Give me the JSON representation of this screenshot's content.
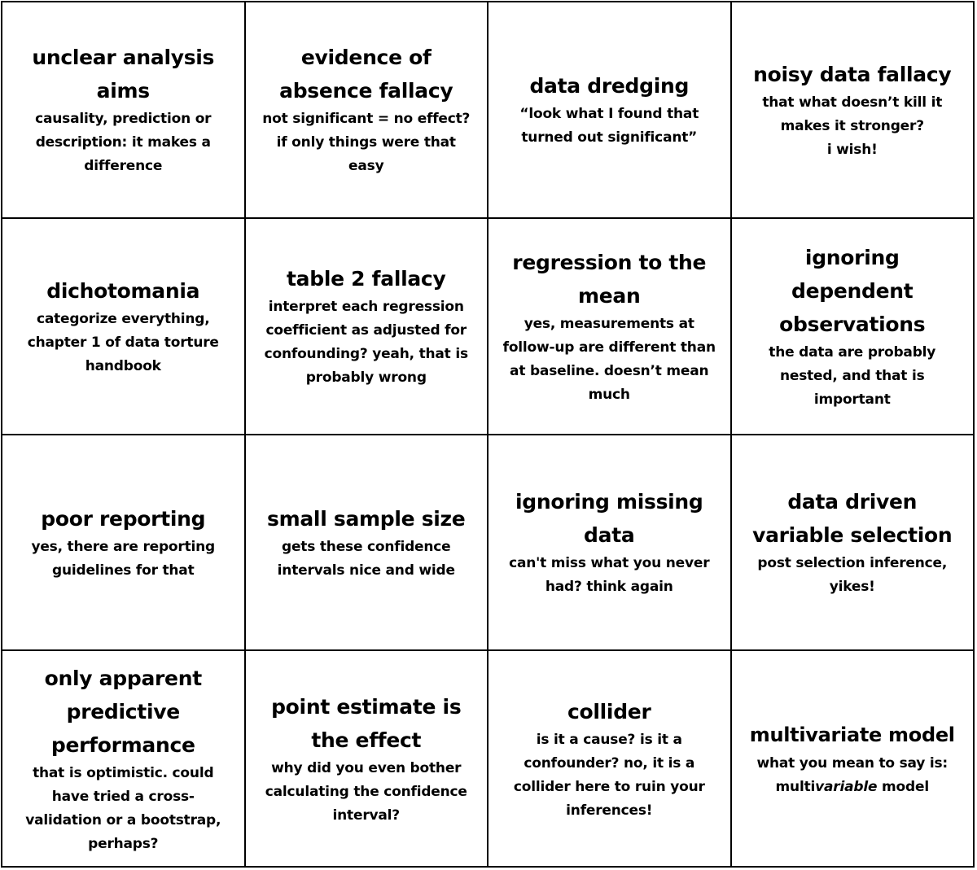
{
  "cells": [
    {
      "title": "unclear analysis aims",
      "desc": "causality, prediction or description: it makes a difference"
    },
    {
      "title": "evidence of absence fallacy",
      "desc": "not significant = no effect? if only things were that easy"
    },
    {
      "title": "data dredging",
      "desc": "“look what I found that turned out significant”"
    },
    {
      "title": "noisy data fallacy",
      "desc_lines": [
        "that what doesn’t kill it makes it stronger?",
        "i wish!"
      ]
    },
    {
      "title": "dichotomania",
      "desc": "categorize everything, chapter 1 of data torture handbook"
    },
    {
      "title": "table 2 fallacy",
      "desc": "interpret each regression coefficient as adjusted for confounding? yeah, that is probably wrong"
    },
    {
      "title": "regression to the mean",
      "desc": "yes, measurements at follow-up are different than at baseline. doesn’t mean much"
    },
    {
      "title": "ignoring dependent observations",
      "desc": "the data are probably nested, and that is important"
    },
    {
      "title": "poor reporting",
      "desc": "yes, there are reporting guidelines for that"
    },
    {
      "title": "small sample size",
      "desc": "gets these confidence intervals nice and wide"
    },
    {
      "title": "ignoring missing data",
      "desc": "can't miss what you never had? think again"
    },
    {
      "title": "data driven variable selection",
      "desc": "post selection inference, yikes!"
    },
    {
      "title": "only apparent predictive performance",
      "desc": "that is optimistic. could have tried a cross-validation or a bootstrap, perhaps?"
    },
    {
      "title": "point estimate is the effect",
      "desc": "why did you even bother calculating the confidence interval?"
    },
    {
      "title": "collider",
      "desc": "is it a cause? is it a confounder? no, it is a collider here to ruin your inferences!"
    },
    {
      "title": "multivariate model",
      "desc_prefix": "what you mean to say is:",
      "desc_pre": "multi",
      "desc_em": "variable",
      "desc_post": " model"
    }
  ]
}
